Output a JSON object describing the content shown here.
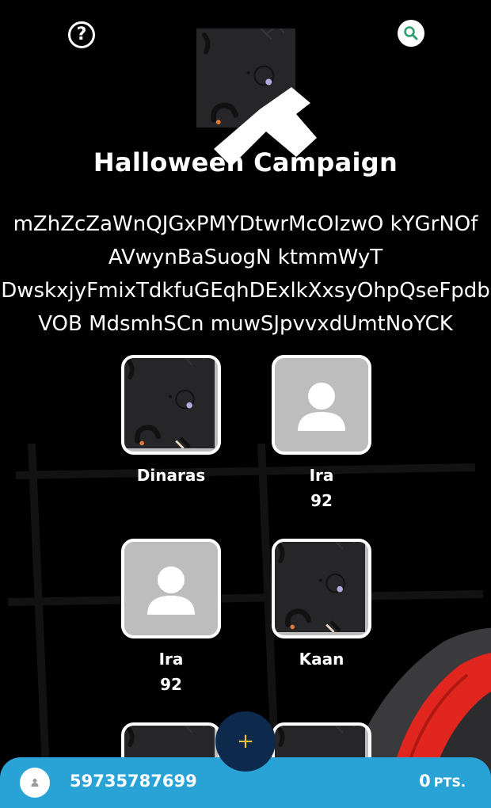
{
  "header": {
    "help_glyph": "?",
    "campaign_title": "Halloween Campaign",
    "description_lines": [
      "mZhZcZaWnQJGxPMYDtwrMcOIzwO kYGrNOf",
      "AVwynBaSuogN ktmmWyT",
      "DwskxjyFmixTdkfuGEqhDExlkXxsyOhpQseFpdb",
      "VOB MdsmhSCn muwSJpvvxdUmtNoYCK"
    ]
  },
  "participants": [
    {
      "name": "Dinaras",
      "score": "",
      "avatar": "pattern-image"
    },
    {
      "name": "Ira",
      "score": "92",
      "avatar": "default-person-icon"
    },
    {
      "name": "Ira",
      "score": "92",
      "avatar": "default-person-icon"
    },
    {
      "name": "Kaan",
      "score": "",
      "avatar": "pattern-image"
    },
    {
      "name": "",
      "score": "",
      "avatar": "pattern-image"
    },
    {
      "name": "",
      "score": "",
      "avatar": "pattern-image"
    }
  ],
  "fab": {
    "glyph": "+"
  },
  "footer": {
    "user_id": "59735787699",
    "points_value": "0",
    "points_unit": "PTS."
  },
  "colors": {
    "background": "#000000",
    "footer": "#29a3d6",
    "fab": "#0d2a4d",
    "fab_plus": "#f2c230",
    "search_icon": "#2e9f6f",
    "placeholder_avatar": "#bdbdbd"
  }
}
